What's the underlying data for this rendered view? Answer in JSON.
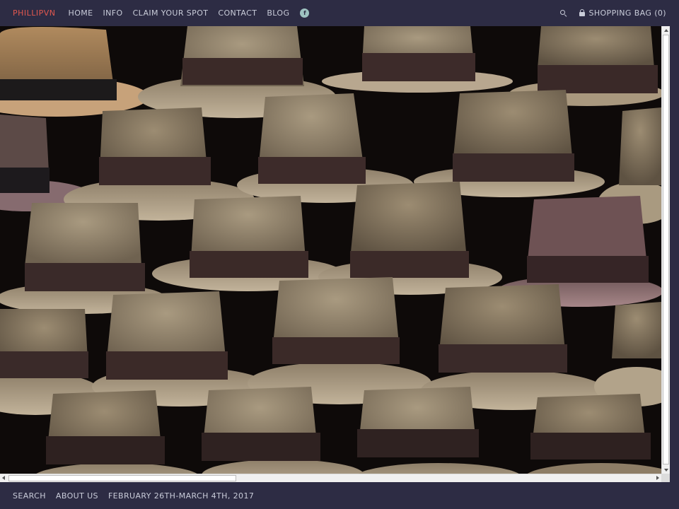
{
  "header": {
    "brand": "PHILLIPVN",
    "nav": [
      {
        "label": "HOME"
      },
      {
        "label": "INFO"
      },
      {
        "label": "CLAIM YOUR SPOT"
      },
      {
        "label": "CONTACT"
      },
      {
        "label": "BLOG"
      }
    ],
    "facebook_glyph": "f",
    "shopping_bag": "SHOPPING BAG (0)"
  },
  "hero": {
    "image": "panama-hats-photo"
  },
  "footer": {
    "links": [
      {
        "label": "SEARCH"
      },
      {
        "label": "ABOUT US"
      },
      {
        "label": "FEBRUARY 26TH-MARCH 4TH, 2017"
      }
    ]
  },
  "colors": {
    "bar_background": "#2d2c44",
    "brand": "#e2584f",
    "nav_text": "#c9ccd9",
    "social_icon": "#9ec2c0"
  }
}
